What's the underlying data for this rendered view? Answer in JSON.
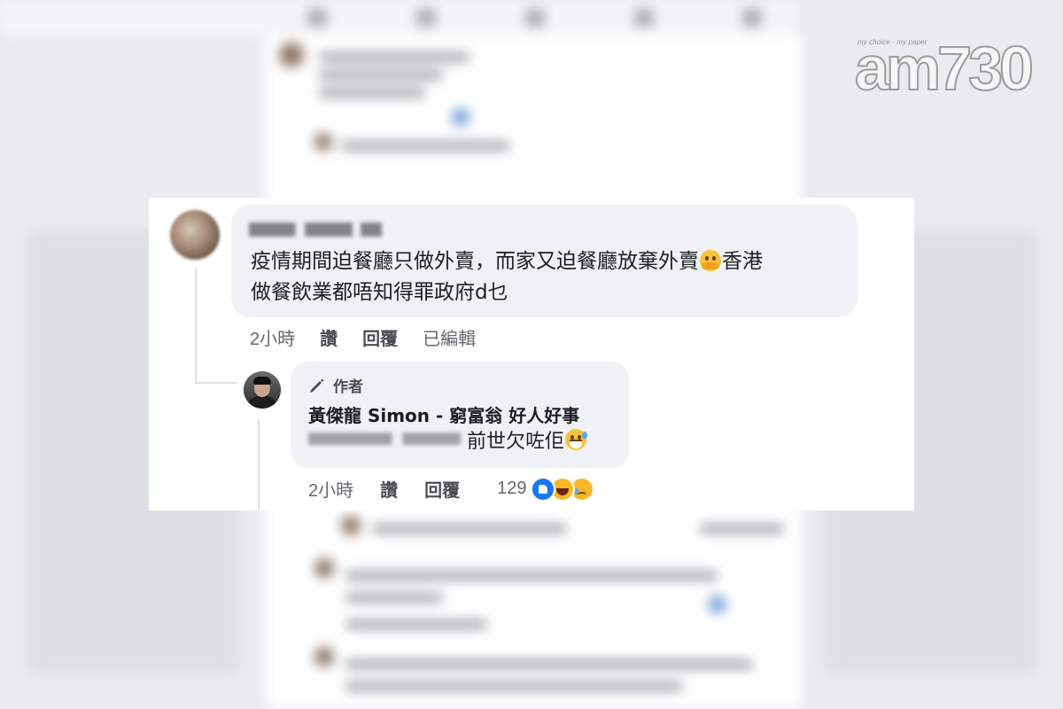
{
  "logo": {
    "tagline": "my choice · my paper",
    "mark": "am730"
  },
  "comment": {
    "text_line1_a": "疫情期間迫餐廳只做外賣，而家又迫餐廳放棄外賣",
    "text_line1_b": "香港",
    "text_line2": "做餐飲業都唔知得罪政府d乜",
    "emoji_icon": "face-with-hand-over-mouth-emoji",
    "time": "2小時",
    "like_label": "讚",
    "reply_label": "回覆",
    "edited_label": "已編輯"
  },
  "reply": {
    "author_badge": "作者",
    "author_name": "黃傑龍 Simon - 窮富翁 好人好事",
    "text": "前世欠咗佢",
    "emoji_icon": "grinning-sweat-emoji",
    "time": "2小時",
    "like_label": "讚",
    "reply_label": "回覆",
    "reaction_count": "129",
    "reactions": [
      "like-reaction-icon",
      "haha-reaction-icon",
      "sad-reaction-icon"
    ]
  },
  "colors": {
    "bubble": "#eff1f4",
    "text": "#1c1e21",
    "meta": "#65676b",
    "like_blue": "#1877f2",
    "emoji_yellow": "#f7b928"
  }
}
